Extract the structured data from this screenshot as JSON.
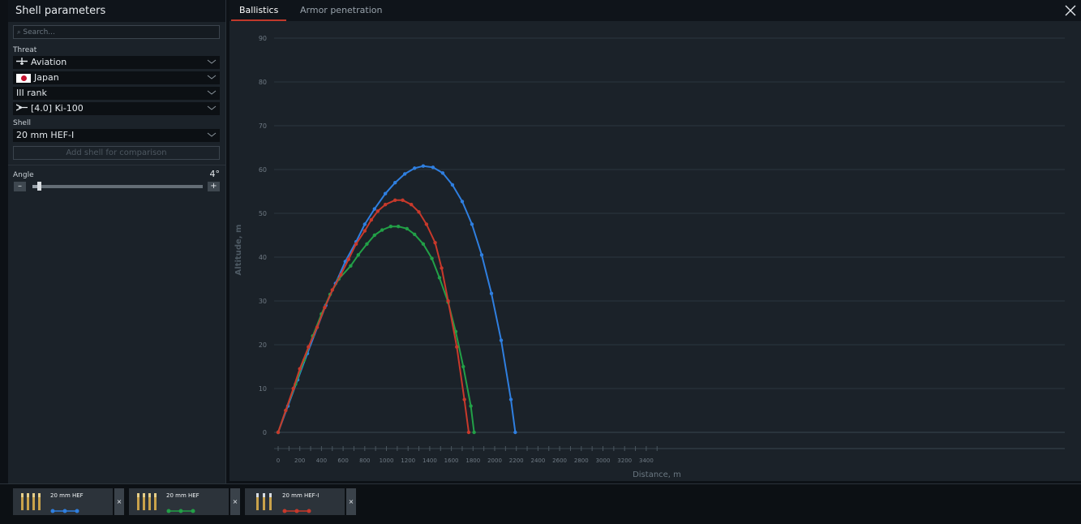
{
  "left_panel": {
    "title": "Shell parameters",
    "search_placeholder": "Search...",
    "threat_label": "Threat",
    "threat_type": "Aviation",
    "nation": "Japan",
    "rank": "III rank",
    "vehicle": "[4.0] Ki-100",
    "shell_label": "Shell",
    "shell": "20 mm HEF-I",
    "add_shell": "Add shell for comparison",
    "angle_label": "Angle",
    "angle_value": "4°",
    "angle_fraction": 0.04,
    "minus": "–",
    "plus": "+"
  },
  "tabs": [
    {
      "label": "Ballistics",
      "active": true
    },
    {
      "label": "Armor penetration",
      "active": false
    }
  ],
  "bottom_cards": [
    {
      "name": "20 mm HEF",
      "color": "#2f7fe0"
    },
    {
      "name": "20 mm HEF",
      "color": "#22a047"
    },
    {
      "name": "20 mm HEF-I",
      "color": "#c8392b"
    }
  ],
  "remove_label": "×",
  "chart_data": {
    "type": "line",
    "xlabel": "Distance, m",
    "ylabel": "Altitude, m",
    "xlim": [
      0,
      3600
    ],
    "ylim": [
      0,
      90
    ],
    "x_ticks": [
      0,
      200,
      400,
      600,
      800,
      1000,
      1200,
      1400,
      1600,
      1800,
      2000,
      2200,
      2400,
      2600,
      2800,
      3000,
      3200,
      3400
    ],
    "y_ticks": [
      0,
      10,
      20,
      30,
      40,
      50,
      60,
      70,
      80,
      90
    ],
    "grid": true,
    "series": [
      {
        "color": "#2f7fe0",
        "points": [
          [
            0,
            0
          ],
          [
            90,
            6
          ],
          [
            180,
            12
          ],
          [
            270,
            18
          ],
          [
            440,
            29
          ],
          [
            530,
            34
          ],
          [
            620,
            39
          ],
          [
            720,
            43.5
          ],
          [
            800,
            47.5
          ],
          [
            890,
            51
          ],
          [
            990,
            54.5
          ],
          [
            1080,
            57
          ],
          [
            1170,
            59
          ],
          [
            1260,
            60.3
          ],
          [
            1340,
            60.8
          ],
          [
            1430,
            60.5
          ],
          [
            1520,
            59.2
          ],
          [
            1610,
            56.5
          ],
          [
            1700,
            52.7
          ],
          [
            1790,
            47.5
          ],
          [
            1880,
            40.5
          ],
          [
            1970,
            31.7
          ],
          [
            2060,
            21
          ],
          [
            2150,
            7.5
          ],
          [
            2190,
            0
          ]
        ]
      },
      {
        "color": "#22a047",
        "points": [
          [
            0,
            0
          ],
          [
            70,
            5
          ],
          [
            160,
            11
          ],
          [
            240,
            16.5
          ],
          [
            320,
            22
          ],
          [
            400,
            27
          ],
          [
            480,
            31.5
          ],
          [
            560,
            35
          ],
          [
            670,
            38
          ],
          [
            740,
            40.5
          ],
          [
            820,
            43
          ],
          [
            890,
            45
          ],
          [
            960,
            46.2
          ],
          [
            1040,
            47
          ],
          [
            1110,
            47
          ],
          [
            1190,
            46.5
          ],
          [
            1260,
            45.2
          ],
          [
            1340,
            43
          ],
          [
            1420,
            39.7
          ],
          [
            1490,
            35.3
          ],
          [
            1570,
            29.7
          ],
          [
            1640,
            23
          ],
          [
            1710,
            15
          ],
          [
            1780,
            6
          ],
          [
            1810,
            0
          ]
        ]
      },
      {
        "color": "#c8392b",
        "points": [
          [
            0,
            0
          ],
          [
            70,
            5
          ],
          [
            140,
            10
          ],
          [
            200,
            14.5
          ],
          [
            280,
            19.5
          ],
          [
            360,
            24
          ],
          [
            430,
            28.5
          ],
          [
            500,
            32.5
          ],
          [
            580,
            36
          ],
          [
            650,
            39.5
          ],
          [
            720,
            43
          ],
          [
            800,
            46
          ],
          [
            860,
            48.5
          ],
          [
            920,
            50.5
          ],
          [
            990,
            52
          ],
          [
            1080,
            53
          ],
          [
            1150,
            53
          ],
          [
            1230,
            52
          ],
          [
            1300,
            50.3
          ],
          [
            1370,
            47.5
          ],
          [
            1450,
            43.3
          ],
          [
            1510,
            37.5
          ],
          [
            1570,
            30
          ],
          [
            1650,
            19.5
          ],
          [
            1720,
            7.5
          ],
          [
            1760,
            0
          ]
        ]
      }
    ]
  }
}
